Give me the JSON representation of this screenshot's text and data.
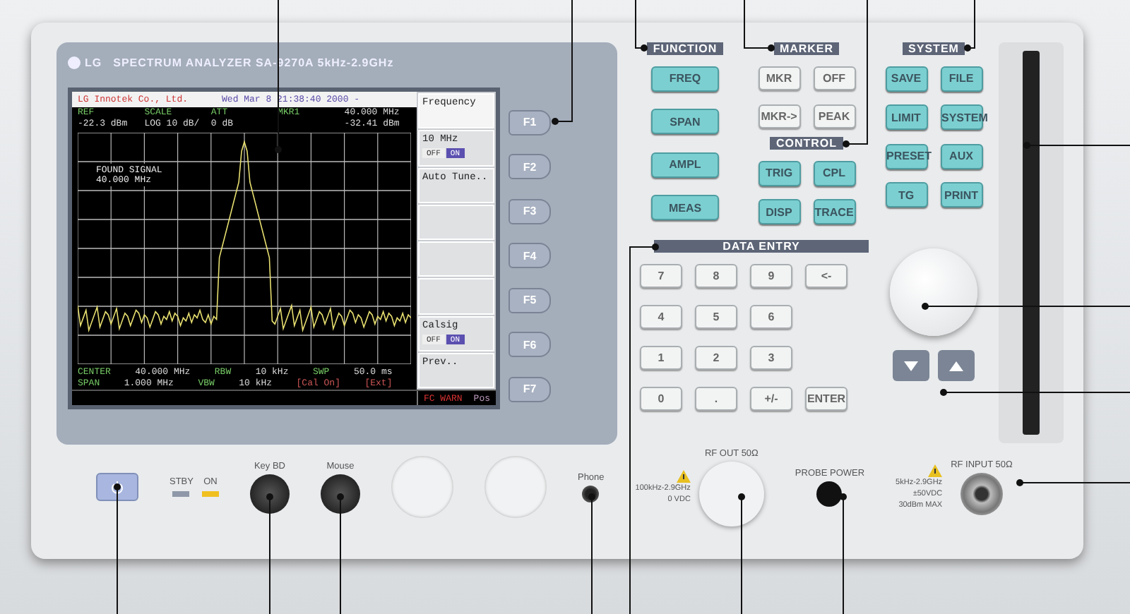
{
  "brand": "LG",
  "title": "SPECTRUM ANALYZER SA-9270A 5kHz-2.9GHz",
  "screen": {
    "company": "LG Innotek Co., Ltd.",
    "datetime": "Wed Mar  8 21:38:40 2000 -",
    "readouts": [
      {
        "label": "REF",
        "value": "-22.3 dBm"
      },
      {
        "label": "SCALE",
        "value": "LOG 10 dB/"
      },
      {
        "label": "ATT",
        "value": "0 dB"
      },
      {
        "label": "MKR1"
      }
    ],
    "marker": {
      "frequency": "40.000 MHz",
      "level": "-32.41 dBm"
    },
    "annotation": [
      "FOUND SIGNAL",
      "40.000 MHz"
    ],
    "footer": [
      [
        {
          "label": "CENTER",
          "value": "40.000 MHz"
        },
        {
          "label": "RBW",
          "value": "10 kHz"
        },
        {
          "label": "SWP",
          "value": "50.0 ms"
        }
      ],
      [
        {
          "label": "SPAN",
          "value": "1.000 MHz"
        },
        {
          "label": "VBW",
          "value": "10 kHz"
        },
        {
          "label": "[Cal On]",
          "value": "[Ext]"
        }
      ]
    ],
    "status": {
      "warning": "FC WARN",
      "mode": "Pos"
    },
    "softkeys": [
      {
        "kind": "title",
        "label": "Frequency"
      },
      {
        "kind": "toggle",
        "label": "10 MHz",
        "options": [
          {
            "label": "OFF",
            "selected": false
          },
          {
            "label": "ON",
            "selected": true
          }
        ]
      },
      {
        "kind": "action",
        "label": "Auto Tune.."
      },
      {
        "kind": "empty"
      },
      {
        "kind": "empty"
      },
      {
        "kind": "empty"
      },
      {
        "kind": "toggle",
        "label": "Calsig",
        "options": [
          {
            "label": "OFF",
            "selected": false
          },
          {
            "label": "ON",
            "selected": true
          }
        ]
      },
      {
        "kind": "action",
        "label": "Prev.."
      }
    ]
  },
  "fkeys": [
    "F1",
    "F2",
    "F3",
    "F4",
    "F5",
    "F6",
    "F7"
  ],
  "function": {
    "title": "FUNCTION",
    "keys": [
      "FREQ",
      "SPAN",
      "AMPL",
      "MEAS"
    ]
  },
  "marker": {
    "title": "MARKER",
    "keys": [
      "MKR",
      "OFF",
      "MKR->",
      "PEAK"
    ]
  },
  "control": {
    "title": "CONTROL",
    "keys": [
      "TRIG",
      "CPL",
      "DISP",
      "TRACE"
    ]
  },
  "system": {
    "title": "SYSTEM",
    "keys": [
      "SAVE",
      "FILE",
      "LIMIT",
      "SYSTEM",
      "PRESET",
      "AUX",
      "TG",
      "PRINT"
    ]
  },
  "data_entry": {
    "title": "DATA ENTRY",
    "keys": [
      "7",
      "8",
      "9",
      "<-",
      "4",
      "5",
      "6",
      "1",
      "2",
      "3",
      "0",
      ".",
      "+/-",
      "ENTER"
    ]
  },
  "indicators": [
    {
      "label": "STBY",
      "on": false
    },
    {
      "label": "ON",
      "on": true
    }
  ],
  "connectors": {
    "keyboard": "Key BD",
    "mouse": "Mouse",
    "phone": "Phone"
  },
  "rf_out": {
    "label": "RF OUT 50Ω",
    "spec": [
      "100kHz-2.9GHz",
      "0 VDC"
    ]
  },
  "probe": {
    "label": "PROBE POWER"
  },
  "rf_in": {
    "label": "RF INPUT 50Ω",
    "spec": [
      "5kHz-2.9GHz",
      "±50VDC",
      "30dBm MAX"
    ]
  }
}
